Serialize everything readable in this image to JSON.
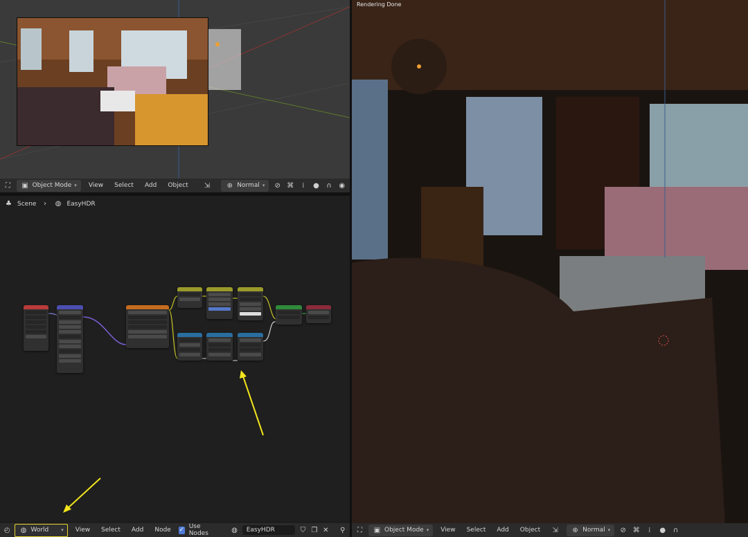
{
  "viewport3d": {
    "header": {
      "mode": "Object Mode",
      "menus": [
        "View",
        "Select",
        "Add",
        "Object"
      ],
      "shading": "Normal"
    }
  },
  "node_editor": {
    "breadcrumb": {
      "scene": "Scene",
      "world": "EasyHDR"
    },
    "footer": {
      "editor_type": "World",
      "menus": [
        "View",
        "Select",
        "Add",
        "Node"
      ],
      "use_nodes_label": "Use Nodes",
      "world_name": "EasyHDR"
    }
  },
  "render_view": {
    "status": "Rendering Done",
    "footer": {
      "mode": "Object Mode",
      "menus": [
        "View",
        "Select",
        "Add",
        "Object"
      ],
      "shading": "Normal"
    }
  },
  "colors": {
    "highlight": "#e6d22c",
    "annotation_arrow": "#f2e51d",
    "node_texture_head": "#c56b1f",
    "node_input_head": "#b93a3a",
    "node_vector_head": "#4c4fb0",
    "node_converter_head": "#9a9a2a",
    "node_shader_head": "#2f8a3a",
    "node_output_head": "#8a2a3a",
    "node_color_head": "#2a6ea0"
  }
}
